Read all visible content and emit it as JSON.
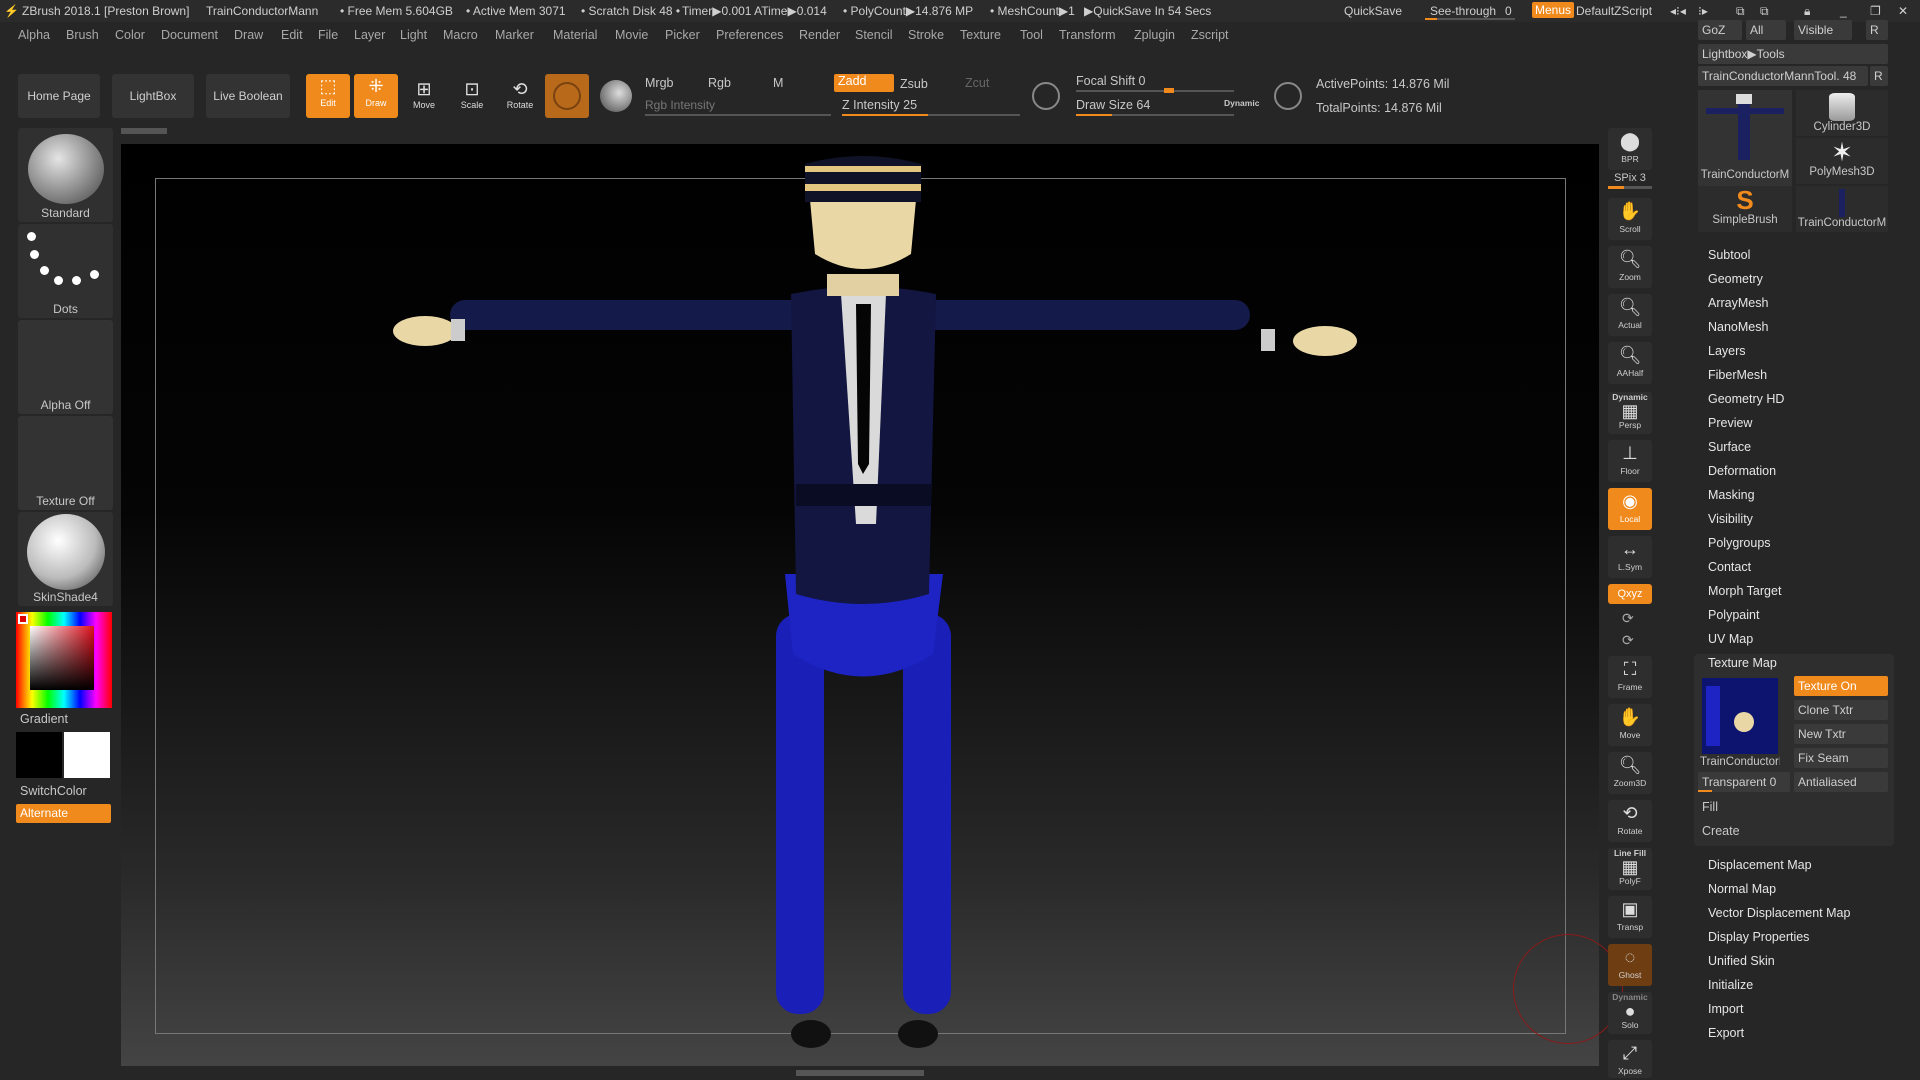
{
  "titlebar": {
    "app": "ZBrush 2018.1 [Preston Brown]",
    "tool": "TrainConductorMann",
    "free_mem": "• Free Mem 5.604GB",
    "active_mem": "• Active Mem 3071",
    "scratch": "• Scratch Disk 48 •",
    "timer": "Timer▶0.001 ATime▶0.014",
    "polycount": "• PolyCount▶14.876 MP",
    "meshcount": "• MeshCount▶1",
    "quicksave_in": "▶QuickSave In 54 Secs",
    "quicksave": "QuickSave",
    "seethrough": "See-through",
    "seethrough_val": "0",
    "menus": "Menus",
    "script": "DefaultZScript"
  },
  "menu": [
    "Alpha",
    "Brush",
    "Color",
    "Document",
    "Draw",
    "Edit",
    "File",
    "Layer",
    "Light",
    "Macro",
    "Marker",
    "Material",
    "Movie",
    "Picker",
    "Preferences",
    "Render",
    "Stencil",
    "Stroke",
    "Texture",
    "Tool",
    "Transform",
    "Zplugin",
    "Zscript"
  ],
  "toolbar": {
    "home": "Home Page",
    "lightbox": "LightBox",
    "liveboolean": "Live Boolean",
    "edit": "Edit",
    "draw": "Draw",
    "move": "Move",
    "scale": "Scale",
    "rotate": "Rotate",
    "mrgb": "Mrgb",
    "rgb": "Rgb",
    "m": "M",
    "rgb_intensity": "Rgb Intensity",
    "zadd": "Zadd",
    "zsub": "Zsub",
    "zcut": "Zcut",
    "z_intensity": "Z Intensity 25",
    "focal_shift": "Focal Shift 0",
    "draw_size": "Draw Size 64",
    "dynamic": "Dynamic",
    "active_points": "ActivePoints: 14.876 Mil",
    "total_points": "TotalPoints: 14.876 Mil"
  },
  "left": {
    "brush": "Standard",
    "stroke": "Dots",
    "alpha": "Alpha Off",
    "texture": "Texture Off",
    "material": "SkinShade4",
    "gradient": "Gradient",
    "switchcolor": "SwitchColor",
    "alternate": "Alternate"
  },
  "rightbar": [
    {
      "name": "bpr",
      "label": "BPR"
    },
    {
      "name": "spix",
      "label": "SPix 3"
    },
    {
      "name": "scroll",
      "label": "Scroll"
    },
    {
      "name": "zoom",
      "label": "Zoom"
    },
    {
      "name": "actual",
      "label": "Actual"
    },
    {
      "name": "aahalf",
      "label": "AAHalf"
    },
    {
      "name": "persp",
      "label": "Persp"
    },
    {
      "name": "floor",
      "label": "Floor"
    },
    {
      "name": "local",
      "label": "Local"
    },
    {
      "name": "lsym",
      "label": "L.Sym"
    },
    {
      "name": "xyz",
      "label": "Qxyz"
    },
    {
      "name": "frame",
      "label": "Frame"
    },
    {
      "name": "move",
      "label": "Move"
    },
    {
      "name": "zoom3d",
      "label": "Zoom3D"
    },
    {
      "name": "rotate",
      "label": "Rotate"
    },
    {
      "name": "polyf",
      "label": "PolyF"
    },
    {
      "name": "transp",
      "label": "Transp"
    },
    {
      "name": "ghost",
      "label": "Ghost"
    },
    {
      "name": "solo",
      "label": "Solo"
    },
    {
      "name": "xpose",
      "label": "Xpose"
    }
  ],
  "rightbar_extra": {
    "dynamic": "Dynamic",
    "linefill": "Line Fill"
  },
  "tool_panel": {
    "goz": "GoZ",
    "all": "All",
    "visible": "Visible",
    "r": "R",
    "lightbox_tools": "Lightbox▶Tools",
    "current_tool": "TrainConductorMannTool. 48",
    "thumbs": [
      "TrainConductorM",
      "Cylinder3D",
      "PolyMesh3D",
      "SimpleBrush",
      "TrainConductorM"
    ],
    "sections_top": [
      "Subtool",
      "Geometry",
      "ArrayMesh",
      "NanoMesh",
      "Layers",
      "FiberMesh",
      "Geometry HD",
      "Preview",
      "Surface",
      "Deformation",
      "Masking",
      "Visibility",
      "Polygroups",
      "Contact",
      "Morph Target",
      "Polypaint",
      "UV Map",
      "Texture Map"
    ],
    "texture_map": {
      "texture_on": "Texture On",
      "clone_txtr": "Clone Txtr",
      "new_txtr": "New Txtr",
      "fix_seam": "Fix Seam",
      "thumb_label": "TrainConductorM",
      "transparent": "Transparent 0",
      "antialiased": "Antialiased",
      "fill": "Fill",
      "create": "Create"
    },
    "sections_bottom": [
      "Displacement Map",
      "Normal Map",
      "Vector Displacement Map",
      "Display Properties",
      "Unified Skin",
      "Initialize",
      "Import",
      "Export"
    ]
  },
  "colors": {
    "accent": "#f08a1c",
    "panel": "#262626"
  }
}
